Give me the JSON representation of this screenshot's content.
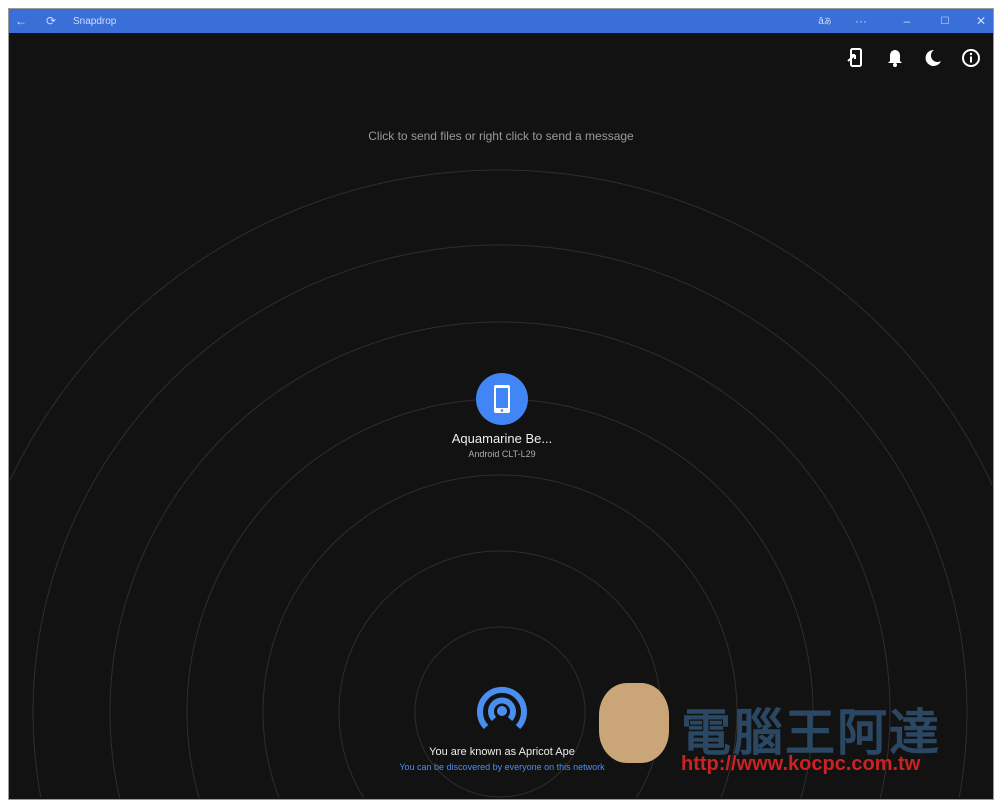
{
  "window": {
    "title": "Snapdrop"
  },
  "toolbar": {
    "icons": [
      "install-icon",
      "notification-bell-icon",
      "dark-mode-moon-icon",
      "info-icon"
    ]
  },
  "hint": "Click to send files or right click to send a message",
  "peer": {
    "name": "Aquamarine Be...",
    "device": "Android CLT-L29",
    "color": "#4285f4"
  },
  "me": {
    "known_as": "You are known as Apricot Ape",
    "discovery": "You can be discovered by everyone on this network"
  },
  "watermark": {
    "title": "電腦王阿達",
    "url": "http://www.kocpc.com.tw"
  }
}
